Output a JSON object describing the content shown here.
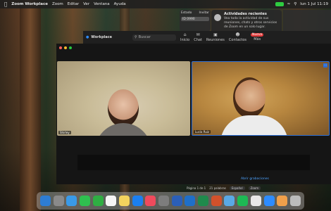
{
  "menubar": {
    "app_name": "Zoom Workplace",
    "items": [
      "Zoom",
      "Editar",
      "Ver",
      "Ventana",
      "Ayuda"
    ],
    "clock": "lun 1 Jul  11:19"
  },
  "toolbar": {
    "app_title": "Workplace",
    "search_placeholder": "Buscar",
    "tools": [
      {
        "icon": "home-icon",
        "label": "Inicio"
      },
      {
        "icon": "chat-icon",
        "label": "Chat"
      },
      {
        "icon": "meetings-icon",
        "label": "Reuniones"
      },
      {
        "icon": "contacts-icon",
        "label": "Contactos"
      },
      {
        "icon": "more-icon",
        "label": "Más"
      }
    ],
    "new_badge": "Nuevo"
  },
  "mini_panel": {
    "title": "Estado",
    "sub": "Invitar",
    "field": "ID 0990"
  },
  "notification": {
    "title": "Actividades recientes",
    "body": "Vea toda la actividad de sus reuniones, chats y otros servicios de Zoom en un solo lugar."
  },
  "meeting": {
    "participants": [
      {
        "name": "Shirley"
      },
      {
        "name": "Lucía Ruiz"
      }
    ],
    "share_link": "Abrir grabaciones",
    "status": [
      "Página 1 de 1",
      "21 palabras",
      "Español",
      "Zoom"
    ]
  },
  "dock": {
    "apps": [
      {
        "icon": "finder-icon",
        "color": "#2d7dd2"
      },
      {
        "icon": "launchpad-icon",
        "color": "#8a8a8a"
      },
      {
        "icon": "safari-icon",
        "color": "#3a9ae8"
      },
      {
        "icon": "messages-icon",
        "color": "#2fbf4f"
      },
      {
        "icon": "facetime-icon",
        "color": "#2fae43"
      },
      {
        "icon": "calendar-icon",
        "color": "#f5f5f5"
      },
      {
        "icon": "notes-icon",
        "color": "#f4d35e"
      },
      {
        "icon": "app-store-icon",
        "color": "#1b7ff0"
      },
      {
        "icon": "music-icon",
        "color": "#f04a5c"
      },
      {
        "icon": "settings-icon",
        "color": "#7d7d7d"
      },
      {
        "icon": "word-icon",
        "color": "#2b5fb8"
      },
      {
        "icon": "outlook-icon",
        "color": "#1f6fc8"
      },
      {
        "icon": "excel-icon",
        "color": "#1f8a4c"
      },
      {
        "icon": "powerpoint-icon",
        "color": "#d2512b"
      },
      {
        "icon": "preview-icon",
        "color": "#5aa9e6"
      },
      {
        "icon": "spotify-icon",
        "color": "#1db954"
      },
      {
        "icon": "chrome-icon",
        "color": "#e8e8e8"
      },
      {
        "icon": "zoom-icon",
        "color": "#2d8cff"
      },
      {
        "icon": "photos-icon",
        "color": "#f0a04b"
      },
      {
        "icon": "trash-icon",
        "color": "#bcbcbc"
      }
    ]
  }
}
